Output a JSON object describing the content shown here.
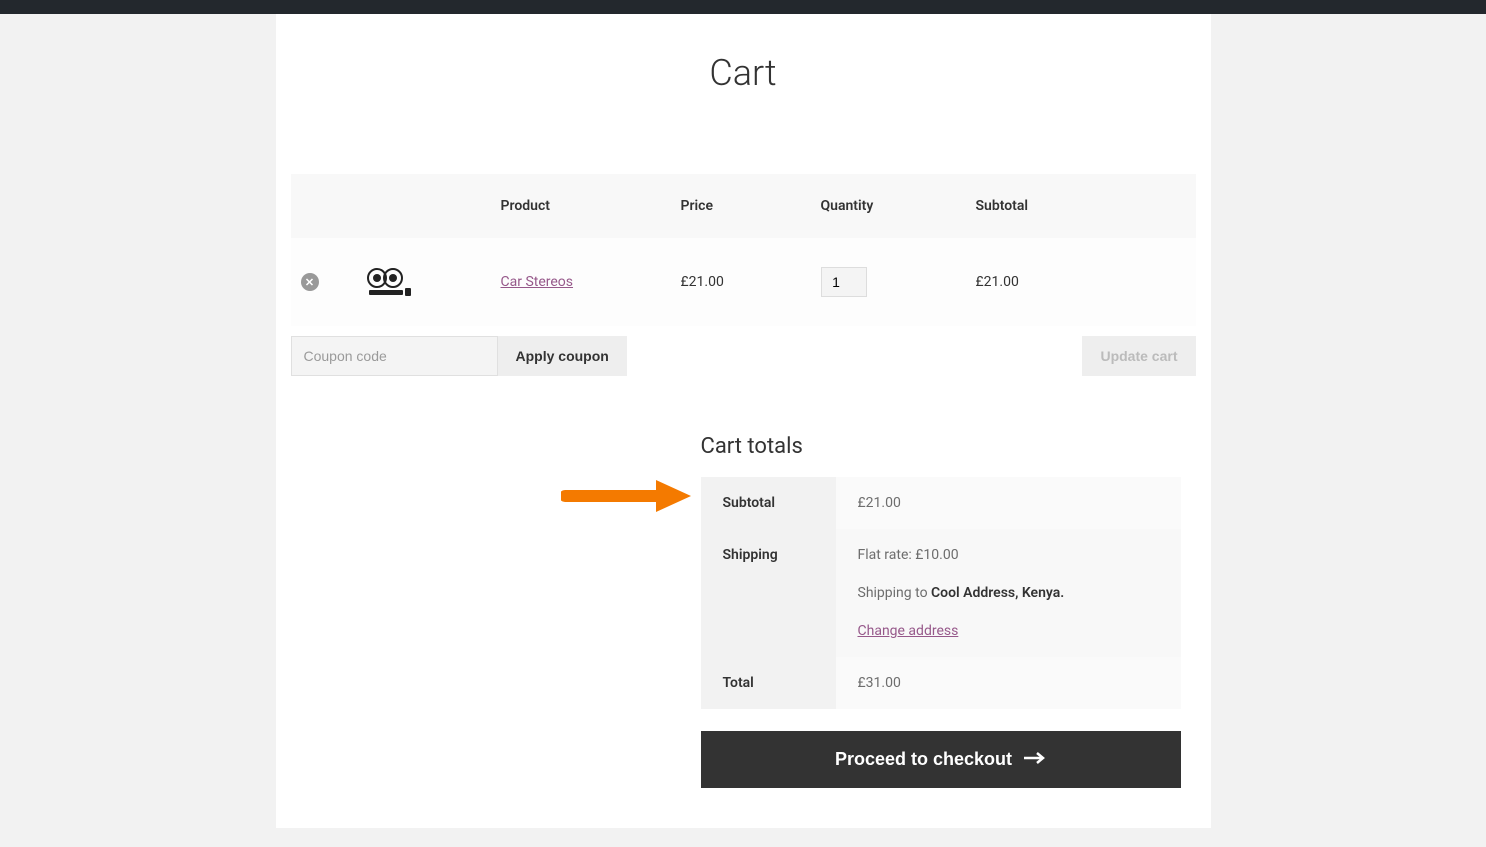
{
  "page": {
    "title": "Cart"
  },
  "table": {
    "headers": {
      "product": "Product",
      "price": "Price",
      "quantity": "Quantity",
      "subtotal": "Subtotal"
    },
    "items": [
      {
        "name": "Car Stereos",
        "price": "£21.00",
        "quantity": "1",
        "subtotal": "£21.00"
      }
    ]
  },
  "coupon": {
    "placeholder": "Coupon code",
    "apply_label": "Apply coupon"
  },
  "actions": {
    "update_cart_label": "Update cart"
  },
  "totals": {
    "title": "Cart totals",
    "subtotal_label": "Subtotal",
    "subtotal_value": "£21.00",
    "shipping_label": "Shipping",
    "shipping_rate": "Flat rate: £10.00",
    "shipping_to_prefix": "Shipping to ",
    "shipping_destination": "Cool Address, Kenya.",
    "change_address_label": "Change address",
    "total_label": "Total",
    "total_value": "£31.00"
  },
  "checkout": {
    "label": "Proceed to checkout"
  }
}
